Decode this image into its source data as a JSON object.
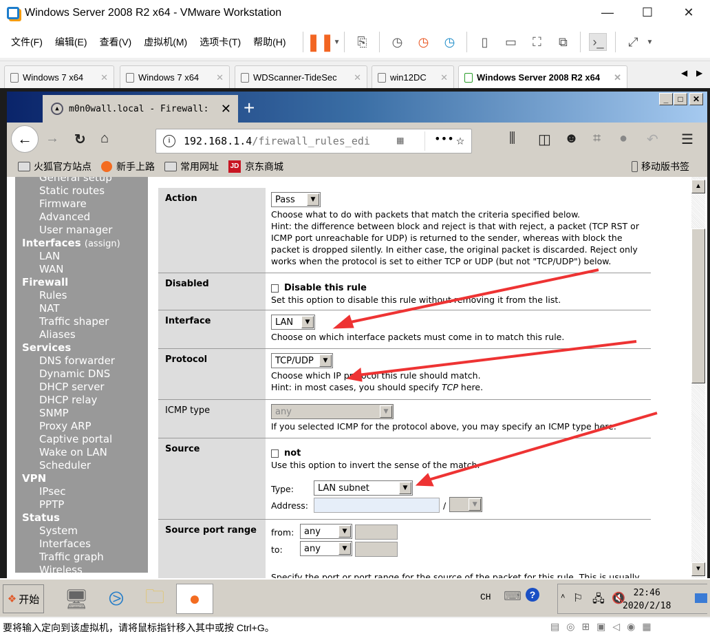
{
  "window": {
    "title": "Windows Server 2008 R2 x64 - VMware Workstation",
    "min": "—",
    "max": "☐",
    "close": "✕"
  },
  "menu": [
    "文件(F)",
    "编辑(E)",
    "查看(V)",
    "虚拟机(M)",
    "选项卡(T)",
    "帮助(H)"
  ],
  "vm_tabs": [
    {
      "label": "Windows 7 x64"
    },
    {
      "label": "Windows 7 x64"
    },
    {
      "label": "WDScanner-TideSec"
    },
    {
      "label": "win12DC"
    },
    {
      "label": "Windows Server 2008 R2 x64",
      "active": true
    }
  ],
  "browser": {
    "tab_title": "m0n0wall.local - Firewall:",
    "new_tab": "+",
    "url_host": "192.168.1.4",
    "url_path": "/firewall_rules_edi",
    "bookmarks": [
      "火狐官方站点",
      "新手上路",
      "常用网址",
      "京东商城"
    ],
    "mobile_bookmarks": "移动版书签"
  },
  "sidebar": [
    {
      "label": "General setup",
      "type": "sub"
    },
    {
      "label": "Static routes",
      "type": "sub"
    },
    {
      "label": "Firmware",
      "type": "sub"
    },
    {
      "label": "Advanced",
      "type": "sub"
    },
    {
      "label": "User manager",
      "type": "sub"
    },
    {
      "label": "Interfaces",
      "type": "hd",
      "extra": "(assign)"
    },
    {
      "label": "LAN",
      "type": "sub"
    },
    {
      "label": "WAN",
      "type": "sub"
    },
    {
      "label": "Firewall",
      "type": "hd"
    },
    {
      "label": "Rules",
      "type": "sub"
    },
    {
      "label": "NAT",
      "type": "sub"
    },
    {
      "label": "Traffic shaper",
      "type": "sub"
    },
    {
      "label": "Aliases",
      "type": "sub"
    },
    {
      "label": "Services",
      "type": "hd"
    },
    {
      "label": "DNS forwarder",
      "type": "sub"
    },
    {
      "label": "Dynamic DNS",
      "type": "sub"
    },
    {
      "label": "DHCP server",
      "type": "sub"
    },
    {
      "label": "DHCP relay",
      "type": "sub"
    },
    {
      "label": "SNMP",
      "type": "sub"
    },
    {
      "label": "Proxy ARP",
      "type": "sub"
    },
    {
      "label": "Captive portal",
      "type": "sub"
    },
    {
      "label": "Wake on LAN",
      "type": "sub"
    },
    {
      "label": "Scheduler",
      "type": "sub"
    },
    {
      "label": "VPN",
      "type": "hd"
    },
    {
      "label": "IPsec",
      "type": "sub"
    },
    {
      "label": "PPTP",
      "type": "sub"
    },
    {
      "label": "Status",
      "type": "hd"
    },
    {
      "label": "System",
      "type": "sub"
    },
    {
      "label": "Interfaces",
      "type": "sub"
    },
    {
      "label": "Traffic graph",
      "type": "sub"
    },
    {
      "label": "Wireless",
      "type": "sub"
    }
  ],
  "form": {
    "action": {
      "label": "Action",
      "value": "Pass",
      "desc": "Choose what to do with packets that match the criteria specified below.",
      "hint": "Hint: the difference between block and reject is that with reject, a packet (TCP RST or ICMP port unreachable for UDP) is returned to the sender, whereas with block the packet is dropped silently. In either case, the original packet is discarded. Reject only works when the protocol is set to either TCP or UDP (but not \"TCP/UDP\") below."
    },
    "disabled": {
      "label": "Disabled",
      "checkbox": "Disable this rule",
      "checked": false,
      "desc": "Set this option to disable this rule without removing it from the list."
    },
    "interface": {
      "label": "Interface",
      "value": "LAN",
      "desc": "Choose on which interface packets must come in to match this rule."
    },
    "protocol": {
      "label": "Protocol",
      "value": "TCP/UDP",
      "desc": "Choose which IP protocol this rule should match.",
      "hint_pre": "Hint: in most cases, you should specify ",
      "hint_em": "TCP",
      "hint_post": " here."
    },
    "icmp": {
      "label": "ICMP type",
      "value": "any",
      "desc": "If you selected ICMP for the protocol above, you may specify an ICMP type here."
    },
    "source": {
      "label": "Source",
      "not_label": "not",
      "checked": false,
      "desc": "Use this option to invert the sense of the match.",
      "type_label": "Type:",
      "type_value": "LAN subnet",
      "address_label": "Address:",
      "address_value": "",
      "slash": "/"
    },
    "srcport": {
      "label": "Source port range",
      "from_label": "from:",
      "from_value": "any",
      "to_label": "to:",
      "to_value": "any",
      "desc": "Specify the port or port range for the source of the packet for this rule. This is usually"
    }
  },
  "taskbar": {
    "start": "开始",
    "lang": "CH",
    "time": "22:46",
    "date": "2020/2/18"
  },
  "status_text": "要将输入定向到该虚拟机，请将鼠标指针移入其中或按 Ctrl+G。",
  "colors": {
    "sidebar": "#999999",
    "label_col": "#dddddd",
    "arrow": "#ee3333",
    "pause": "#f26522"
  }
}
